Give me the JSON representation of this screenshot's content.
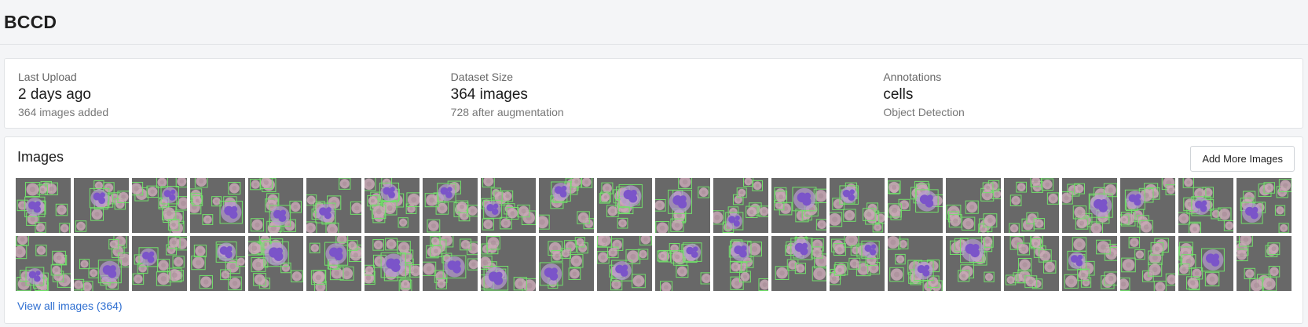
{
  "header": {
    "title": "BCCD"
  },
  "stats": [
    {
      "label": "Last Upload",
      "value": "2 days ago",
      "sub": "364 images added"
    },
    {
      "label": "Dataset Size",
      "value": "364 images",
      "sub": "728 after augmentation"
    },
    {
      "label": "Annotations",
      "value": "cells",
      "sub": "Object Detection"
    }
  ],
  "images": {
    "title": "Images",
    "add_button_label": "Add More Images",
    "view_all_label": "View all images (364)",
    "thumbnail_rows": 2,
    "thumbnails_per_row": 22
  },
  "colors": {
    "link": "#2f6fd1",
    "bounding_box": "#72e16b",
    "cell": "#c9a9b6",
    "nucleus": "#7b54c9",
    "background": "#686868"
  }
}
